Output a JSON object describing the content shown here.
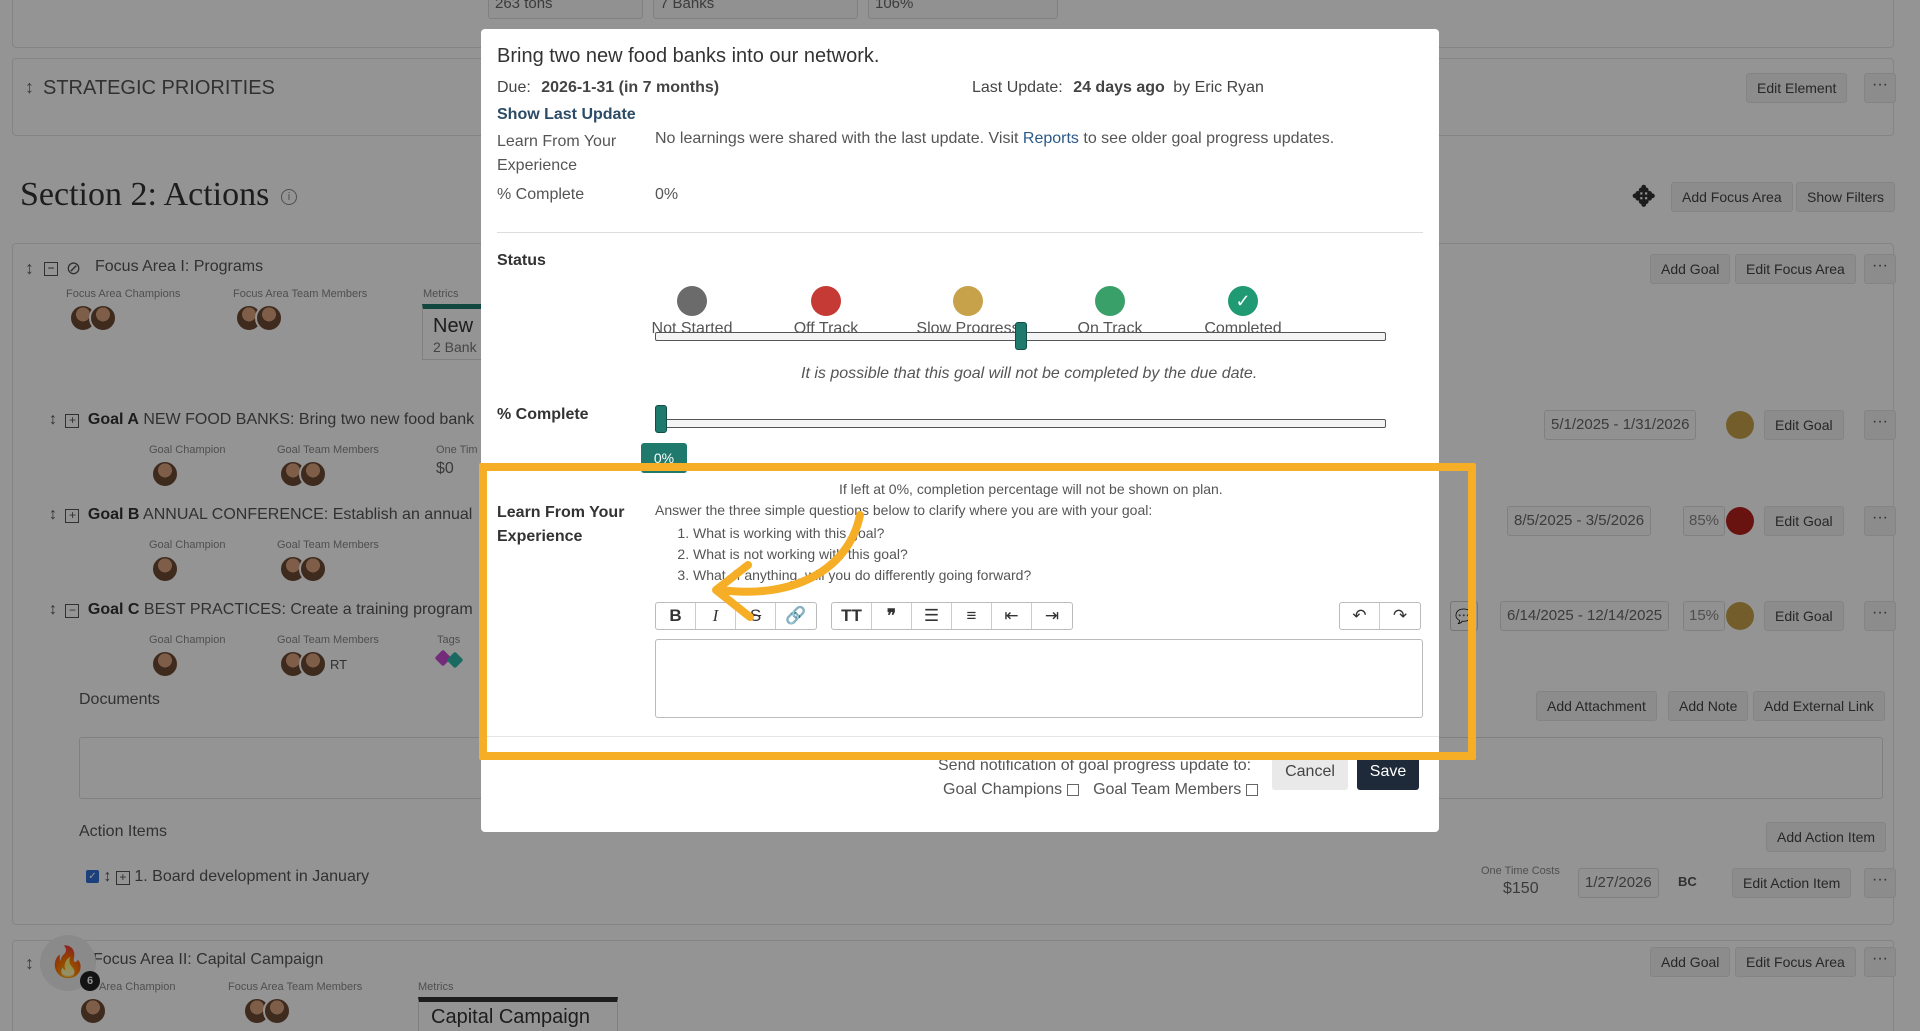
{
  "background": {
    "metrics_top": [
      "263 tons",
      "7 Banks",
      "106%"
    ],
    "strategic_priorities": "STRATEGIC PRIORITIES",
    "edit_element": "Edit Element",
    "more": "···",
    "section_title": "Section 2: Actions",
    "add_focus_area": "Add Focus Area",
    "show_filters": "Show Filters",
    "focus_area_1": {
      "title": "Focus Area I: Programs",
      "champions_label": "Focus Area Champions",
      "team_label": "Focus Area Team Members",
      "metrics_label": "Metrics",
      "metric_name": "New",
      "metric_value": "2 Bank",
      "add_goal": "Add Goal",
      "edit_focus_area": "Edit Focus Area"
    },
    "goals": [
      {
        "id": "Goal A",
        "title": "NEW FOOD BANKS: Bring two new food bank",
        "champion_label": "Goal Champion",
        "team_label": "Goal Team Members",
        "cost_label": "One Tim",
        "cost": "$0",
        "dates": "5/1/2025 - 1/31/2026",
        "pct": "",
        "edit": "Edit Goal"
      },
      {
        "id": "Goal B",
        "title": "ANNUAL CONFERENCE: Establish an annual",
        "champion_label": "Goal Champion",
        "team_label": "Goal Team Members",
        "dates": "8/5/2025 - 3/5/2026",
        "pct": "85%",
        "edit": "Edit Goal"
      },
      {
        "id": "Goal C",
        "title": "BEST PRACTICES: Create a training program",
        "champion_label": "Goal Champion",
        "team_label": "Goal Team Members",
        "tags_label": "Tags",
        "initials": "RT",
        "dates": "6/14/2025 - 12/14/2025",
        "pct": "15%",
        "edit": "Edit Goal"
      }
    ],
    "documents": "Documents",
    "add_attachment": "Add Attachment",
    "add_note": "Add Note",
    "add_external_link": "Add External Link",
    "action_items": "Action Items",
    "add_action_item": "Add Action Item",
    "action_item_1": {
      "num": "1.",
      "text": "Board development in January",
      "cost_label": "One Time Costs",
      "cost": "$150",
      "date": "1/27/2026",
      "initials": "BC",
      "edit": "Edit Action Item"
    },
    "focus_area_2": {
      "title": "Focus Area II: Capital Campaign",
      "champion_label": "Area Champion",
      "team_label": "Focus Area Team Members",
      "metrics_label": "Metrics",
      "metric_name": "Capital Campaign",
      "add_goal": "Add Goal",
      "edit_focus_area": "Edit Focus Area"
    },
    "badge_count": "6"
  },
  "modal": {
    "title": "Bring two new food banks into our network.",
    "due_label": "Due:",
    "due_value": "2026-1-31 (in 7 months)",
    "last_update_label": "Last Update:",
    "last_update_value": "24 days ago",
    "last_update_by": "by Eric Ryan",
    "show_last_update": "Show Last Update",
    "learn_label": "Learn From Your Experience",
    "learn_text_1": "No learnings were shared with the last update. Visit ",
    "learn_link": "Reports",
    "learn_text_2": " to see older goal progress updates.",
    "complete_label": "% Complete",
    "complete_value": "0%",
    "status_label": "Status",
    "statuses": [
      {
        "label": "Not Started",
        "color": "#6b6b6b"
      },
      {
        "label": "Off Track",
        "color": "#c63a36"
      },
      {
        "label": "Slow Progress",
        "color": "#c7a24a"
      },
      {
        "label": "On Track",
        "color": "#3aa06a"
      },
      {
        "label": "Completed",
        "color": "#1f9a72"
      }
    ],
    "status_level": 0.5,
    "status_note": "It is possible that this goal will not be completed by the due date.",
    "pct_complete_label": "% Complete",
    "pct_complete_value": 0,
    "pct_badge": "0%",
    "pct_hint": "If left at 0%, completion percentage will not be shown on plan.",
    "learn2_label": "Learn From Your Experience",
    "questions_intro": "Answer the three simple questions below to clarify where you are with your goal:",
    "questions": [
      "What is working with this goal?",
      "What is not working with this goal?",
      "What, if anything, will you do differently going forward?"
    ],
    "editor_placeholder": "",
    "notify_label": "Send notification of goal progress update to:",
    "notify_champions": "Goal Champions",
    "notify_team": "Goal Team Members",
    "cancel": "Cancel",
    "save": "Save"
  },
  "colors": {
    "highlight": "#f5ae26",
    "save_bg": "#1e2a3a",
    "teal": "#1f7a6d"
  }
}
